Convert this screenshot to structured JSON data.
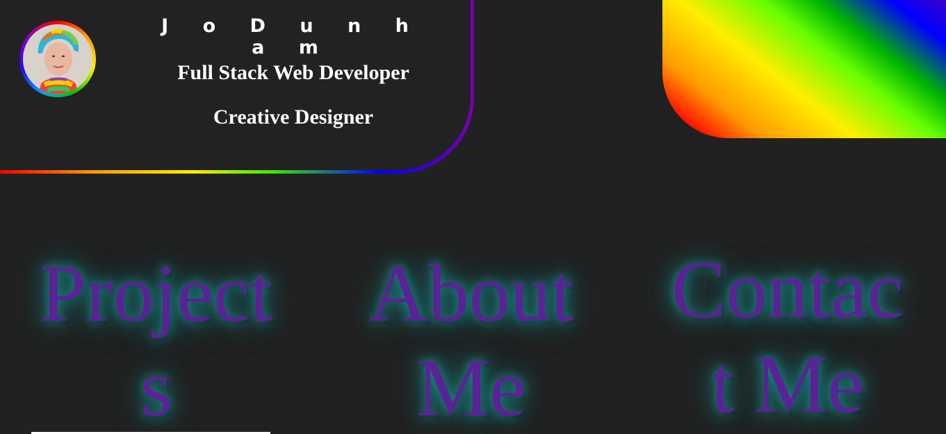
{
  "header": {
    "name": "J o D u n h a m",
    "role_1": "Full Stack Web Developer",
    "role_2": "Creative Designer",
    "avatar_icon": "profile-photo"
  },
  "nav": {
    "projects": "Projects",
    "about": "About Me",
    "contact": "Contact Me"
  },
  "colors": {
    "background": "#212121",
    "nav_text": "#5b2196",
    "nav_glow": "#1f8a8a",
    "header_text": "#ffffff"
  }
}
